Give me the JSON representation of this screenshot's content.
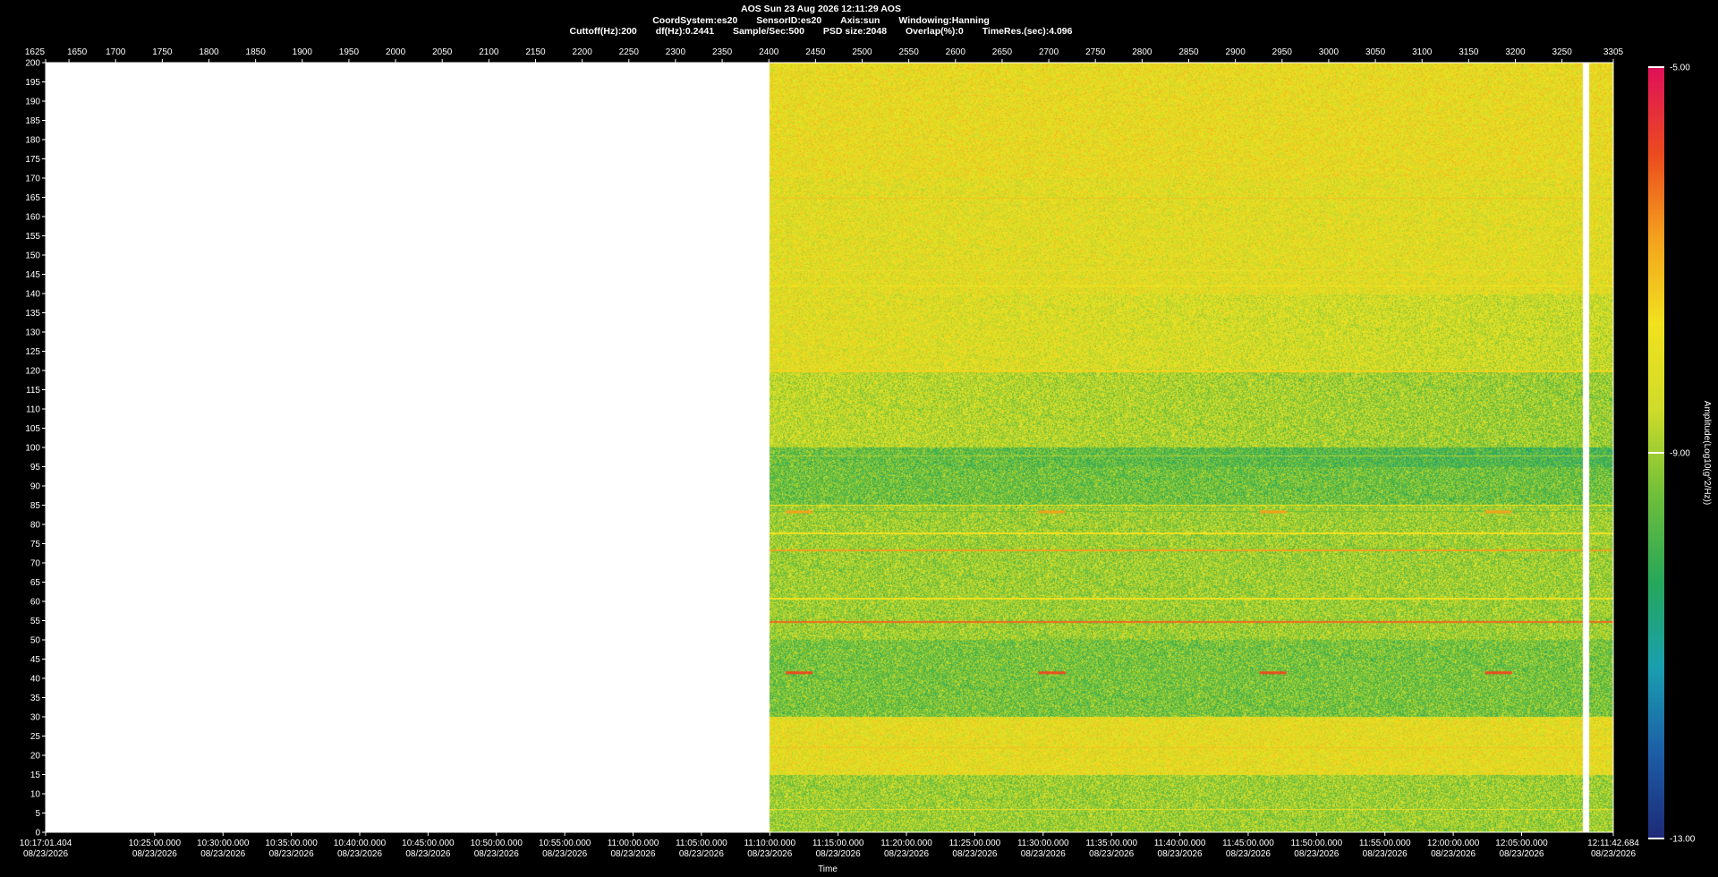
{
  "header": {
    "line1": "AOS  Sun 23 Aug 2026 12:11:29  AOS",
    "line2": [
      "CoordSystem:es20",
      "SensorID:es20",
      "Axis:sun",
      "Windowing:Hanning"
    ],
    "line3": [
      "Cuttoff(Hz):200",
      "df(Hz):0.2441",
      "Sample/Sec:500",
      "PSD size:2048",
      "Overlap(%):0",
      "TimeRes.(sec):4.096"
    ]
  },
  "chart_data": {
    "type": "heatmap",
    "title": "AOS  Sun 23 Aug 2026 12:11:29  AOS",
    "xlabel": "Time",
    "ylabel": "",
    "y_ticks": [
      0,
      5,
      10,
      15,
      20,
      25,
      30,
      35,
      40,
      45,
      50,
      55,
      60,
      65,
      70,
      75,
      80,
      85,
      90,
      95,
      100,
      105,
      110,
      115,
      120,
      125,
      130,
      135,
      140,
      145,
      150,
      155,
      160,
      165,
      170,
      175,
      180,
      185,
      190,
      195,
      200
    ],
    "ylim": [
      0,
      200
    ],
    "top_axis_ticks": [
      1625,
      1650,
      1700,
      1750,
      1800,
      1850,
      1900,
      1950,
      2000,
      2050,
      2100,
      2150,
      2200,
      2250,
      2300,
      2350,
      2400,
      2450,
      2500,
      2550,
      2600,
      2650,
      2700,
      2750,
      2800,
      2850,
      2900,
      2950,
      3000,
      3050,
      3100,
      3150,
      3200,
      3250,
      3305
    ],
    "top_axis_range": [
      1625,
      3305
    ],
    "x_start_label": "10:17:01.404",
    "x_end_label": "12:11:42.684",
    "x_ticks": [
      "10:25:00.000",
      "10:30:00.000",
      "10:35:00.000",
      "10:40:00.000",
      "10:45:00.000",
      "10:50:00.000",
      "10:55:00.000",
      "11:00:00.000",
      "11:05:00.000",
      "11:10:00.000",
      "11:15:00.000",
      "11:20:00.000",
      "11:25:00.000",
      "11:30:00.000",
      "11:35:00.000",
      "11:40:00.000",
      "11:45:00.000",
      "11:50:00.000",
      "11:55:00.000",
      "12:00:00.000",
      "12:05:00.000"
    ],
    "x_date": "08/23/2026",
    "data_start_time": "11:10:00",
    "colorbar": {
      "label": "Amplitude(Log10(g^2/Hz))",
      "min": -13.0,
      "max": -5.0,
      "ticks": [
        "-5.00",
        "-9.00",
        "-13.00"
      ],
      "colors": [
        "#1e2a78",
        "#1d5ea8",
        "#1a9fb0",
        "#27a85a",
        "#6fbf3a",
        "#cfdc2a",
        "#f2e21f",
        "#f5a21d",
        "#ec4a1f",
        "#e0105a"
      ]
    },
    "tones_hz": [
      6,
      22,
      41.5,
      55,
      61,
      73.5,
      78,
      83.5,
      85,
      98,
      120,
      142,
      146,
      165
    ]
  }
}
